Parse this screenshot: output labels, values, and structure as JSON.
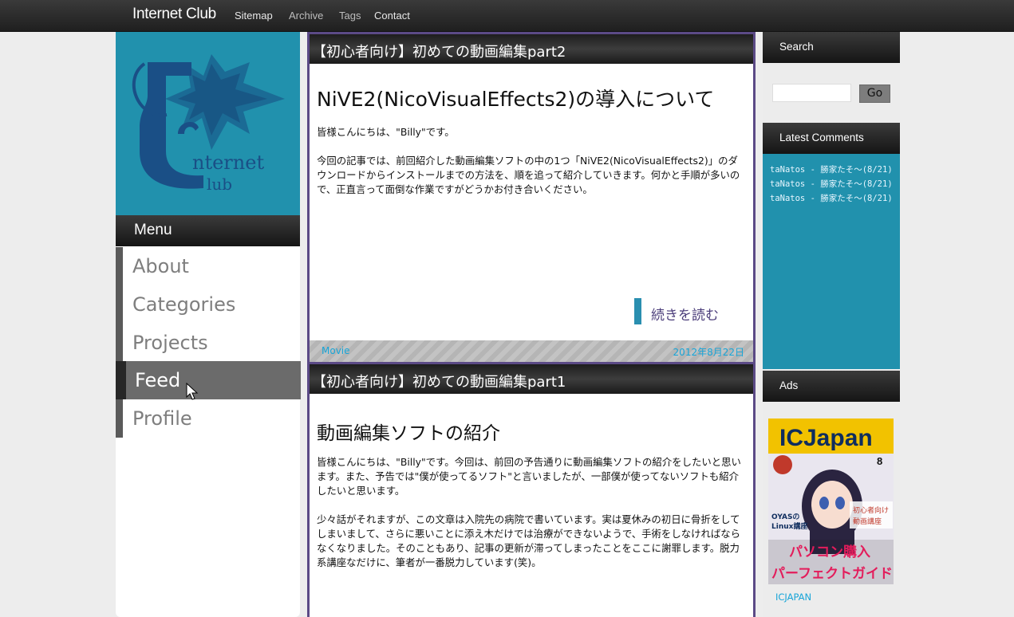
{
  "topbar": {
    "brand": "Internet Club",
    "nav": [
      "Sitemap",
      "Archive",
      "Tags",
      "Contact"
    ]
  },
  "logo": {
    "line1": "nternet",
    "line2": "lub"
  },
  "menu": {
    "heading": "Menu",
    "items": [
      "About",
      "Categories",
      "Projects",
      "Feed",
      "Profile"
    ],
    "active": "Feed"
  },
  "posts": [
    {
      "title": "【初心者向け】初めての動画編集part2",
      "heading": "NiVE2(NicoVisualEffects2)の導入について",
      "paragraphs": [
        "皆様こんにちは、\"Billy\"です。",
        "今回の記事では、前回紹介した動画編集ソフトの中の1つ「NiVE2(NicoVisualEffects2)」のダウンロードからインストールまでの方法を、順を追って紹介していきます。何かと手順が多いので、正直言って面倒な作業ですがどうかお付き合いください。"
      ],
      "read_more": "続きを読む",
      "category": "Movie",
      "date": "2012年8月22日"
    },
    {
      "title": "【初心者向け】初めての動画編集part1",
      "heading": "動画編集ソフトの紹介",
      "paragraphs": [
        "皆様こんにちは、\"Billy\"です。今回は、前回の予告通りに動画編集ソフトの紹介をしたいと思います。また、予告では\"僕が使ってるソフト\"と言いましたが、一部僕が使ってないソフトも紹介したいと思います。",
        "少々話がそれますが、この文章は入院先の病院で書いています。実は夏休みの初日に骨折をしてしまいまして、さらに悪いことに添え木だけでは治療ができないようで、手術をしなければならなくなりました。そのこともあり、記事の更新が滞ってしまったことをここに謝罪します。脱力系講座なだけに、筆者が一番脱力しています(笑)。"
      ]
    }
  ],
  "sidebar": {
    "search_heading": "Search",
    "go_label": "Go",
    "comments_heading": "Latest Comments",
    "comments": [
      "taNatos - 勝家たそ～(8/21)",
      "taNatos - 勝家たそ～(8/21)",
      "taNatos - 勝家たそ～(8/21)"
    ],
    "ads_heading": "Ads",
    "ad": {
      "masthead": "ICJapan",
      "issue": "8",
      "text1": "初心者向け",
      "text2": "動画講座",
      "text3": "OYASの",
      "text4": "Linux講座",
      "text5": "パソコン購入",
      "text6": "パーフェクトガイド"
    },
    "ad_caption": "ICJAPAN"
  },
  "colors": {
    "teal": "#2191ad",
    "post_border": "#5b4a86",
    "link": "#17a5d8"
  }
}
